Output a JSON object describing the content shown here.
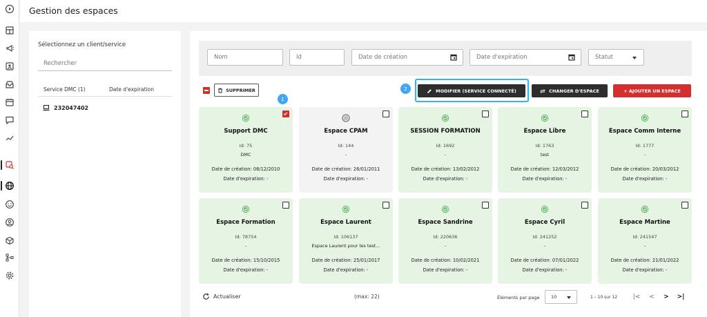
{
  "header": {
    "title": "Gestion des espaces"
  },
  "rail": {
    "icons": [
      "play-circle-icon",
      "dashboard-icon",
      "megaphone-icon",
      "contact-icon",
      "inbox-icon",
      "calendar-icon",
      "chat-icon",
      "trend-icon",
      "spaces-search-icon",
      "globe-icon",
      "smiley-icon",
      "user-circle-icon",
      "packages-icon",
      "tree-icon",
      "gear-icon"
    ]
  },
  "client_panel": {
    "label": "Sélectionnez un client/service",
    "search_placeholder": "Rechercher",
    "col_service": "Service DMC (1)",
    "col_expiry": "Date d'expiration",
    "client": "232047402"
  },
  "filters": {
    "name_placeholder": "Nom",
    "id_placeholder": "Id",
    "created_placeholder": "Date de création",
    "expiry_placeholder": "Date d'expiration",
    "status_placeholder": "Statut"
  },
  "actions": {
    "delete": "SUPPRIMER",
    "edit": "MODIFIER (SERVICE CONNECTÉ)",
    "change": "CHANGER D'ESPACE",
    "add": "+ AJOUTER UN ESPACE",
    "step1": "1",
    "step2": "2"
  },
  "cards": [
    {
      "title": "Support DMC",
      "id": "Id: 75",
      "desc": "DMC",
      "created": "Date de création: 08/12/2010",
      "expiry": "Date d'expiration: -",
      "active": true,
      "checked": true
    },
    {
      "title": "Espace CPAM",
      "id": "Id: 144",
      "desc": "-",
      "created": "Date de création: 26/01/2011",
      "expiry": "Date d'expiration: -",
      "active": false,
      "checked": false
    },
    {
      "title": "SESSION FORMATION",
      "id": "Id: 1692",
      "desc": "-",
      "created": "Date de création: 13/02/2012",
      "expiry": "Date d'expiration: -",
      "active": true,
      "checked": false
    },
    {
      "title": "Espace Libre",
      "id": "Id: 1763",
      "desc": "test",
      "created": "Date de création: 12/03/2012",
      "expiry": "Date d'expiration: -",
      "active": true,
      "checked": false
    },
    {
      "title": "Espace Comm Interne",
      "id": "Id: 1777",
      "desc": "-",
      "created": "Date de création: 20/03/2012",
      "expiry": "Date d'expiration: -",
      "active": true,
      "checked": false
    },
    {
      "title": "Espace Formation",
      "id": "Id: 78754",
      "desc": "-",
      "created": "Date de création: 15/10/2015",
      "expiry": "Date d'expiration: -",
      "active": true,
      "checked": false
    },
    {
      "title": "Espace Laurent",
      "id": "Id: 106137",
      "desc": "Espace Laurent pour les test...",
      "created": "Date de création: 25/01/2017",
      "expiry": "Date d'expiration: -",
      "active": true,
      "checked": false
    },
    {
      "title": "Espace Sandrine",
      "id": "Id: 220636",
      "desc": "-",
      "created": "Date de création: 10/02/2021",
      "expiry": "Date d'expiration: -",
      "active": true,
      "checked": false
    },
    {
      "title": "Espace Cyril",
      "id": "Id: 241252",
      "desc": "-",
      "created": "Date de création: 07/01/2022",
      "expiry": "Date d'expiration: -",
      "active": true,
      "checked": false
    },
    {
      "title": "Espace Martine",
      "id": "Id: 241547",
      "desc": "-",
      "created": "Date de création: 21/01/2022",
      "expiry": "Date d'expiration: -",
      "active": true,
      "checked": false
    }
  ],
  "footer": {
    "refresh": "Actualiser",
    "max": "(max: 22)",
    "per_page_label": "Éléments par page",
    "per_page_value": "10",
    "range": "1 – 10 sur 12",
    "first": "|<",
    "prev": "<",
    "next": ">",
    "last": ">|"
  },
  "colors": {
    "accent_red": "#d32f2f",
    "highlight_blue": "#29b6f6",
    "active_green": "#4caf50",
    "card_green": "#e6f4e4"
  }
}
